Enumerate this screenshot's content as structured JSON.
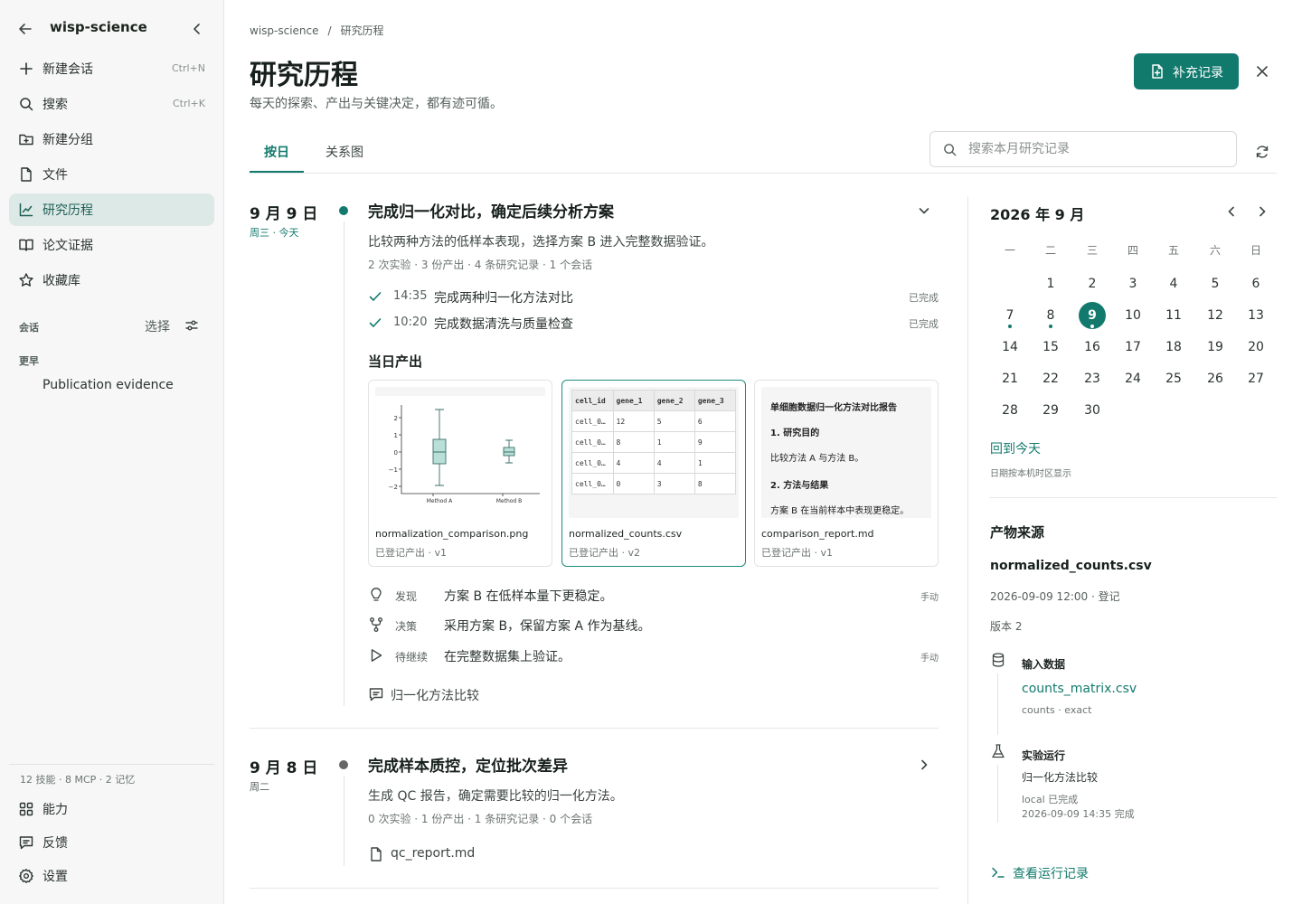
{
  "sidebar": {
    "title": "wisp-science",
    "nav": [
      {
        "label": "新建会话",
        "shortcut": "Ctrl+N",
        "icon": "plus-icon"
      },
      {
        "label": "搜索",
        "shortcut": "Ctrl+K",
        "icon": "search-icon"
      },
      {
        "label": "新建分组",
        "shortcut": "",
        "icon": "folder-plus-icon"
      },
      {
        "label": "文件",
        "shortcut": "",
        "icon": "file-icon"
      },
      {
        "label": "研究历程",
        "shortcut": "",
        "icon": "chart-line-icon"
      },
      {
        "label": "论文证据",
        "shortcut": "",
        "icon": "book-open-icon"
      },
      {
        "label": "收藏库",
        "shortcut": "",
        "icon": "star-icon"
      }
    ],
    "sessions_label": "会话",
    "select_label": "选择",
    "earlier_label": "更早",
    "conversation": "Publication evidence",
    "stats": "12 技能 · 8 MCP · 2 记忆",
    "bottom": [
      {
        "label": "能力",
        "icon": "grid-icon"
      },
      {
        "label": "反馈",
        "icon": "message-icon"
      },
      {
        "label": "设置",
        "icon": "gear-icon"
      }
    ]
  },
  "header": {
    "breadcrumb": [
      "wisp-science",
      "研究历程"
    ],
    "title": "研究历程",
    "subtitle": "每天的探索、产出与关键决定，都有迹可循。",
    "add_button": "补充记录"
  },
  "tabs": [
    "按日",
    "关系图"
  ],
  "search": {
    "placeholder": "搜索本月研究记录",
    "value": ""
  },
  "day1": {
    "date": "9 月 9 日",
    "weekday": "周三 · 今天",
    "title": "完成归一化对比，确定后续分析方案",
    "desc": "比较两种方法的低样本表现，选择方案 B 进入完整数据验证。",
    "meta": "2 次实验 · 3 份产出 · 4 条研究记录 · 1 个会话",
    "tasks": [
      {
        "time": "14:35",
        "text": "完成两种归一化方法对比",
        "status": "已完成"
      },
      {
        "time": "10:20",
        "text": "完成数据清洗与质量检查",
        "status": "已完成"
      }
    ],
    "outputs_label": "当日产出",
    "outputs": [
      {
        "name": "normalization_comparison.png",
        "meta": "已登记产出 · v1"
      },
      {
        "name": "normalized_counts.csv",
        "meta": "已登记产出 · v2"
      },
      {
        "name": "comparison_report.md",
        "meta": "已登记产出 · v1"
      }
    ],
    "plot": {
      "yticks": [
        "2",
        "1",
        "0",
        "−1",
        "−2"
      ],
      "categories": [
        "Method A",
        "Method B"
      ]
    },
    "table": [
      [
        "cell_id",
        "gene_1",
        "gene_2",
        "gene_3"
      ],
      [
        "cell_0…",
        "12",
        "5",
        "6"
      ],
      [
        "cell_0…",
        "8",
        "1",
        "9"
      ],
      [
        "cell_0…",
        "4",
        "4",
        "1"
      ],
      [
        "cell_0…",
        "0",
        "3",
        "8"
      ]
    ],
    "doc": {
      "title": "单细胞数据归一化方法对比报告",
      "h1": "1. 研究目的",
      "p1": "比较方法 A 与方法 B。",
      "h2": "2. 方法与结果",
      "p2": "方案 B 在当前样本中表现更稳定。"
    },
    "notes": [
      {
        "kind": "发现",
        "text": "方案 B 在低样本量下更稳定。",
        "tag": "手动"
      },
      {
        "kind": "决策",
        "text": "采用方案 B，保留方案 A 作为基线。",
        "tag": ""
      },
      {
        "kind": "待继续",
        "text": "在完整数据集上验证。",
        "tag": "手动"
      }
    ],
    "session": "归一化方法比较"
  },
  "day2": {
    "date": "9 月 8 日",
    "weekday": "周二",
    "title": "完成样本质控，定位批次差异",
    "desc": "生成 QC 报告，确定需要比较的归一化方法。",
    "meta": "0 次实验 · 1 份产出 · 1 条研究记录 · 0 个会话",
    "file": "qc_report.md"
  },
  "calendar": {
    "title": "2026 年 9 月",
    "weekdays": [
      "一",
      "二",
      "三",
      "四",
      "五",
      "六",
      "日"
    ],
    "selected_day": "9",
    "today_link": "回到今天",
    "note": "日期按本机时区显示",
    "weeks": [
      [
        "",
        "1",
        "2",
        "3",
        "4",
        "5",
        "6"
      ],
      [
        "7",
        "8",
        "9",
        "10",
        "11",
        "12",
        "13"
      ],
      [
        "14",
        "15",
        "16",
        "17",
        "18",
        "19",
        "20"
      ],
      [
        "21",
        "22",
        "23",
        "24",
        "25",
        "26",
        "27"
      ],
      [
        "28",
        "29",
        "30",
        "",
        "",
        "",
        ""
      ]
    ]
  },
  "provenance": {
    "heading": "产物来源",
    "file": "normalized_counts.csv",
    "time": "2026-09-09 12:00 · 登记",
    "version": "版本 2",
    "input_label": "输入数据",
    "input_file": "counts_matrix.csv",
    "input_meta": "counts · exact",
    "run_label": "实验运行",
    "run_name": "归一化方法比较",
    "run_status": "local 已完成",
    "run_time": "2026-09-09 14:35 完成",
    "view_runs": "查看运行记录"
  },
  "colors": {
    "accent": "#127a6d",
    "active_bg": "#dde9e6",
    "sidebar_bg": "#f6f7f6"
  }
}
